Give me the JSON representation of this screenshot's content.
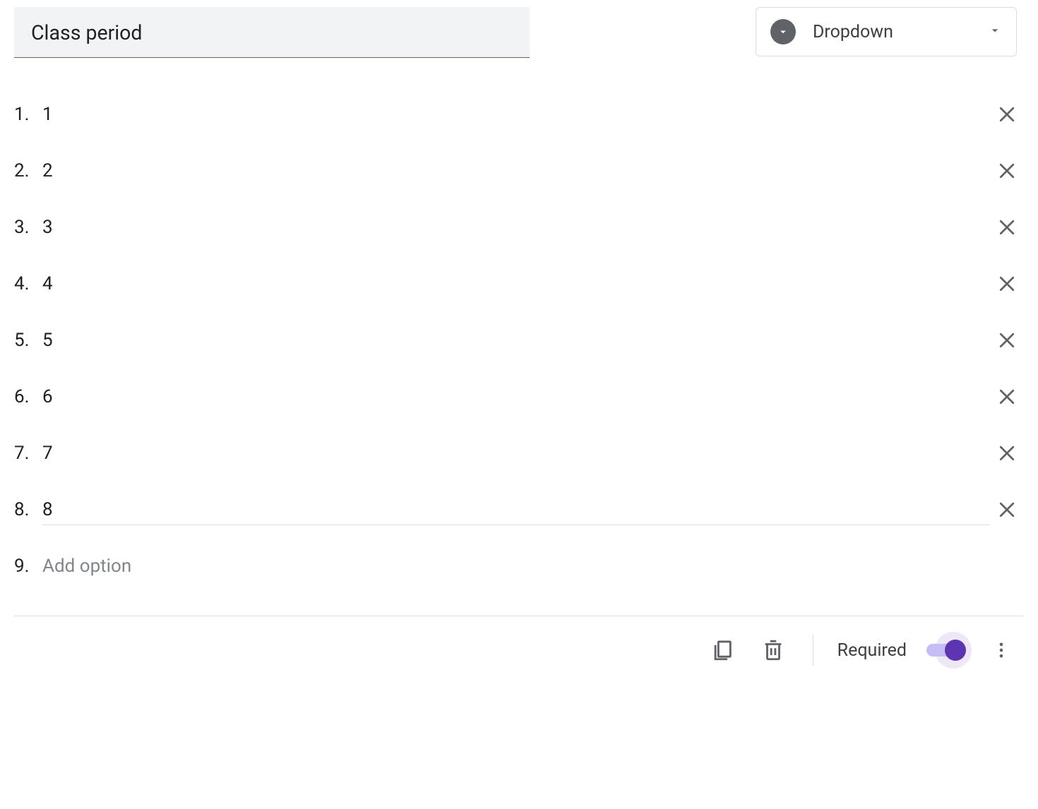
{
  "question": {
    "title": "Class period"
  },
  "typeSelector": {
    "label": "Dropdown"
  },
  "options": [
    {
      "n": "1.",
      "label": "1",
      "focused": false
    },
    {
      "n": "2.",
      "label": "2",
      "focused": false
    },
    {
      "n": "3.",
      "label": "3",
      "focused": false
    },
    {
      "n": "4.",
      "label": "4",
      "focused": false
    },
    {
      "n": "5.",
      "label": "5",
      "focused": false
    },
    {
      "n": "6.",
      "label": "6",
      "focused": false
    },
    {
      "n": "7.",
      "label": "7",
      "focused": false
    },
    {
      "n": "8.",
      "label": "8",
      "focused": true
    }
  ],
  "addOption": {
    "n": "9.",
    "placeholder": "Add option"
  },
  "footer": {
    "requiredLabel": "Required",
    "requiredOn": true
  }
}
